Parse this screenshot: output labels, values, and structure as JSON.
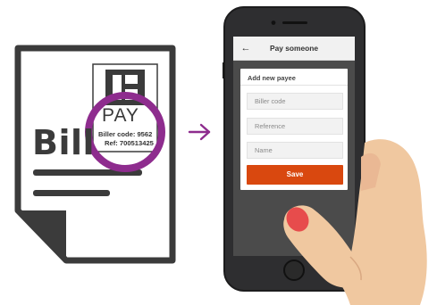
{
  "colors": {
    "accent_purple": "#8e2c8e",
    "save_orange": "#d9480f",
    "phone_body": "#2e2e30",
    "screen_bg": "#4b4b4b",
    "skin": "#f0c8a0",
    "nail": "#e74c4c"
  },
  "bill": {
    "word": "Bill",
    "bpay_word": "PAY",
    "biller_code_line": "Biller code: 9562",
    "ref_line": "Ref: 700513425",
    "logo_icon": "bpay-b-logo"
  },
  "arrow": {
    "icon": "arrow-right-icon"
  },
  "app": {
    "header_title": "Pay someone",
    "back_icon": "←",
    "card_title": "Add new payee",
    "fields": [
      {
        "placeholder": "Biller code"
      },
      {
        "placeholder": "Reference"
      },
      {
        "placeholder": "Name"
      }
    ],
    "save_label": "Save"
  }
}
